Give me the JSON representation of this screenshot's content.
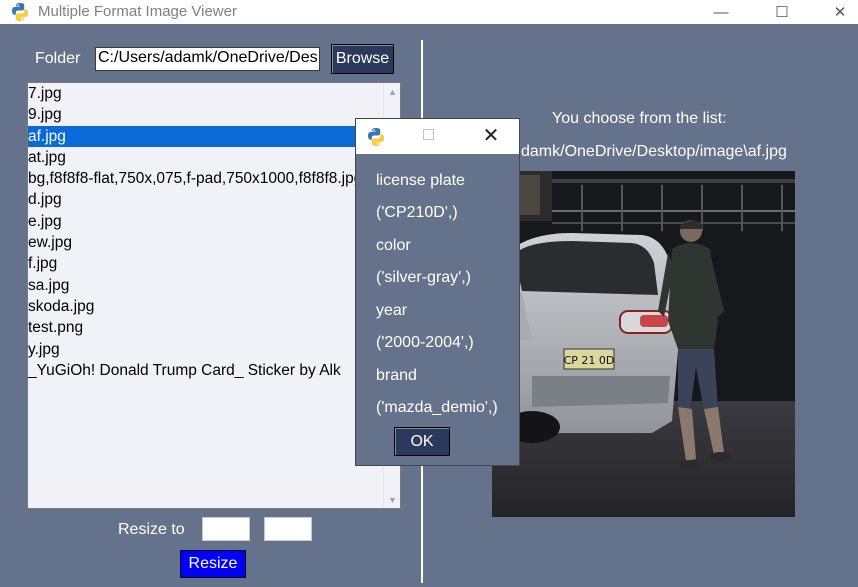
{
  "window": {
    "title": "Multiple Format Image Viewer",
    "minimize_symbol": "—",
    "maximize_symbol": "☐",
    "close_symbol": "✕"
  },
  "folder": {
    "label": "Folder",
    "path": "C:/Users/adamk/OneDrive/Des",
    "browse_label": "Browse"
  },
  "file_list": {
    "items": [
      "7.jpg",
      "9.jpg",
      "af.jpg",
      "at.jpg",
      "bg,f8f8f8-flat,750x,075,f-pad,750x1000,f8f8f8.jpg",
      "d.jpg",
      "e.jpg",
      "ew.jpg",
      "f.jpg",
      "sa.jpg",
      "skoda.jpg",
      "test.png",
      "y.jpg",
      "_YuGiOh! Donald Trump Card_ Sticker by Alk"
    ],
    "selected_index": 2,
    "scroll_up_symbol": "▲",
    "scroll_down_symbol": "▼"
  },
  "resize": {
    "label": "Resize to",
    "width_value": "",
    "height_value": "",
    "button_label": "Resize"
  },
  "preview": {
    "choose_label": "You choose from the list:",
    "path_text": "damk/OneDrive/Desktop/image\\af.jpg"
  },
  "dialog": {
    "close_symbol": "✕",
    "lines": [
      "license plate",
      "('CP210D',)",
      "color",
      "('silver-gray',)",
      "year",
      "('2000-2004',)",
      "brand",
      "('mazda_demio',)"
    ],
    "ok_label": "OK"
  },
  "photo": {
    "plate_text": "CP 21 0D"
  },
  "colors": {
    "background": "#64738b",
    "button_dark": "#2b3a5c",
    "resize_button": "#0000ff",
    "selection": "#0a6ad8"
  }
}
